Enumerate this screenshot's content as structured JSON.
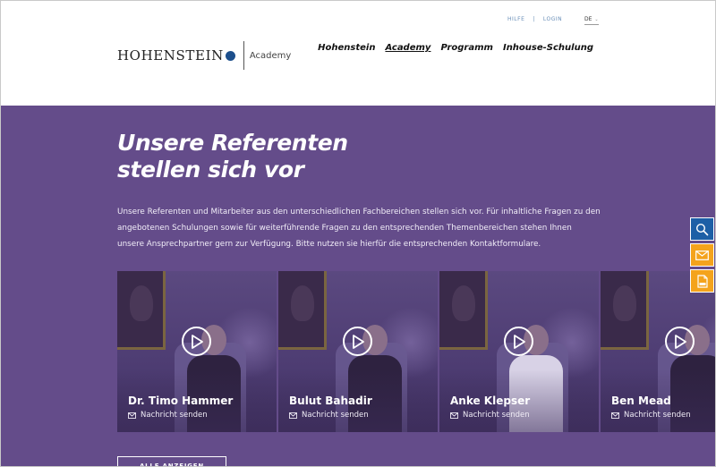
{
  "header": {
    "utility": {
      "help": "HILFE",
      "separator": "|",
      "login": "LOGIN"
    },
    "language": "DE",
    "logo": {
      "name": "HOHENSTEIN",
      "sub": "Academy",
      "dot_color": "#1d4f8c"
    },
    "nav": [
      {
        "label": "Hohenstein",
        "active": false
      },
      {
        "label": "Academy",
        "active": true
      },
      {
        "label": "Programm",
        "active": false
      },
      {
        "label": "Inhouse-Schulung",
        "active": false
      }
    ]
  },
  "hero": {
    "title_line1": "Unsere Referenten",
    "title_line2": "stellen sich vor",
    "intro": "Unsere Referenten und Mitarbeiter aus den unterschiedlichen Fachbereichen stellen sich vor. Für inhaltliche Fragen zu den angebotenen Schulungen sowie für weiterführende Fragen zu den entsprechenden Themenbereichen stehen Ihnen unsere Ansprechpartner gern zur Verfügung. Bitte nutzen sie hierfür die entsprechenden Kontaktformulare.",
    "background": "#644c8a"
  },
  "speakers": [
    {
      "name": "Dr. Timo Hammer",
      "message": "Nachricht senden"
    },
    {
      "name": "Bulut Bahadir",
      "message": "Nachricht senden"
    },
    {
      "name": "Anke Klepser",
      "message": "Nachricht senden"
    },
    {
      "name": "Ben Mead",
      "message": "Nachricht senden"
    }
  ],
  "show_all_button": "ALLE ANZEIGEN",
  "side_tabs": [
    {
      "icon": "search-icon",
      "color": "#1d5fa6"
    },
    {
      "icon": "mail-icon",
      "color": "#f4a31c"
    },
    {
      "icon": "pdf-icon",
      "color": "#f4a31c"
    }
  ]
}
